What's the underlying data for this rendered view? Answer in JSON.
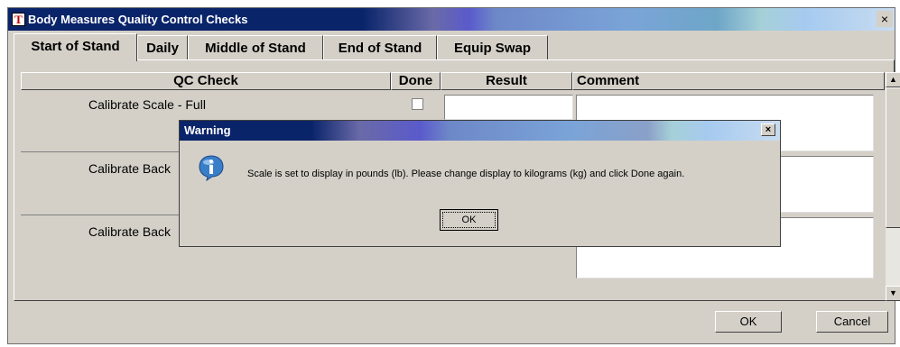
{
  "window": {
    "title": "Body Measures Quality Control Checks",
    "icon": "app-icon",
    "close_glyph": "×"
  },
  "tabs": [
    {
      "label": "Start of Stand",
      "active": true
    },
    {
      "label": "Daily",
      "active": false
    },
    {
      "label": "Middle of Stand",
      "active": false
    },
    {
      "label": "End of Stand",
      "active": false
    },
    {
      "label": "Equip Swap",
      "active": false
    }
  ],
  "table": {
    "columns": [
      "QC Check",
      "Done",
      "Result",
      "Comment"
    ],
    "rows": [
      {
        "check": "Calibrate Scale - Full",
        "done": false,
        "result": "",
        "comment": ""
      },
      {
        "check": "Calibrate Back",
        "done": false,
        "result": "",
        "comment": ""
      },
      {
        "check": "Calibrate Back",
        "done": false,
        "result": "",
        "comment": ""
      }
    ]
  },
  "footer": {
    "ok_label": "OK",
    "cancel_label": "Cancel"
  },
  "dialog": {
    "title": "Warning",
    "icon": "info-icon",
    "message": "Scale is set to display in pounds (lb).  Please change display to kilograms (kg) and click Done again.",
    "ok_label": "OK",
    "close_glyph": "×"
  },
  "colors": {
    "titlebar_start": "#0a246a",
    "titlebar_end": "#a6caf0",
    "face": "#d4d0c8"
  }
}
